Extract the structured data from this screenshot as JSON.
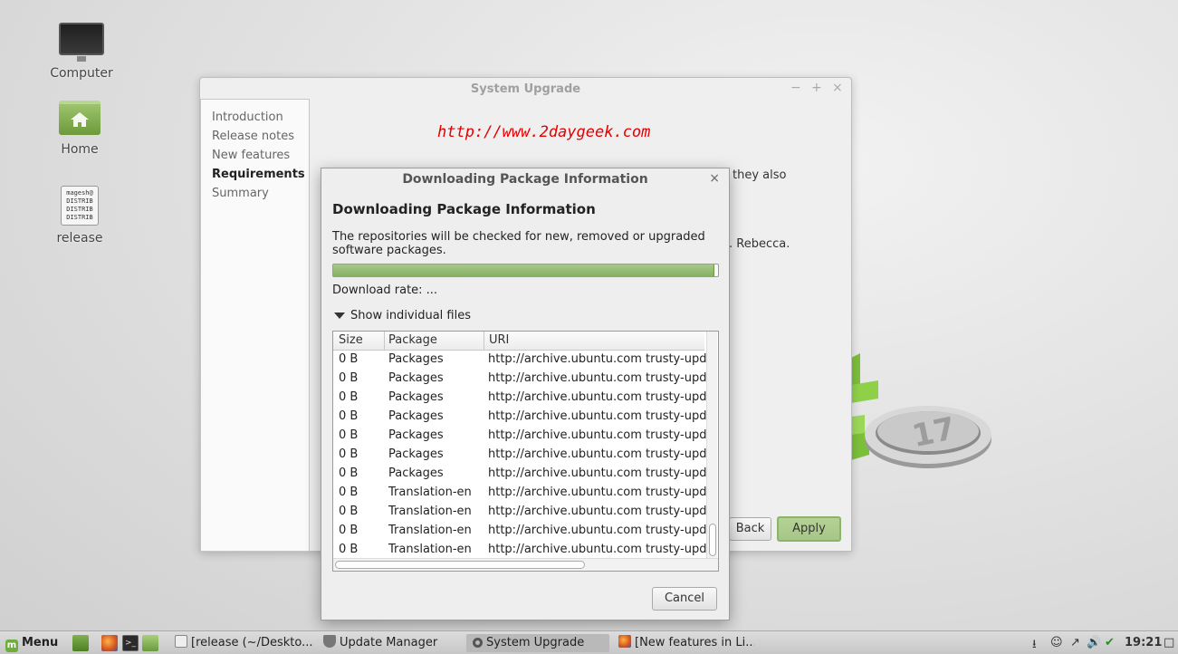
{
  "desktop": {
    "icons": [
      {
        "label": "Computer",
        "icon": "computer-icon"
      },
      {
        "label": "Home",
        "icon": "home-folder-icon"
      },
      {
        "label": "release",
        "icon": "text-file-icon",
        "preview": "magesh@\nDISTRIB\nDISTRIB\nDISTRIB"
      }
    ]
  },
  "main_window": {
    "title": "System Upgrade",
    "controls": {
      "minimize": "−",
      "maximize": "+",
      "close": "×"
    },
    "sidebar": [
      {
        "label": "Introduction",
        "active": false
      },
      {
        "label": "Release notes",
        "active": false
      },
      {
        "label": "New features",
        "active": false
      },
      {
        "label": "Requirements",
        "active": true
      },
      {
        "label": "Summary",
        "active": false
      }
    ],
    "watermark_url": "http://www.2daygeek.com",
    "peek_text_1": "they also",
    "peek_text_2": ". Rebecca.",
    "back_label": "Back",
    "apply_label": "Apply"
  },
  "dialog": {
    "title": "Downloading Package Information",
    "close": "×",
    "heading": "Downloading Package Information",
    "description": "The repositories will be checked for new, removed or upgraded software packages.",
    "progress": 0.99,
    "download_rate": "Download rate: ...",
    "expander_label": "Show individual files",
    "columns": [
      "Size",
      "Package",
      "URI"
    ],
    "rows": [
      [
        "0  B",
        "Packages",
        "http://archive.ubuntu.com trusty-updat"
      ],
      [
        "0  B",
        "Packages",
        "http://archive.ubuntu.com trusty-updat"
      ],
      [
        "0  B",
        "Packages",
        "http://archive.ubuntu.com trusty-updat"
      ],
      [
        "0  B",
        "Packages",
        "http://archive.ubuntu.com trusty-updat"
      ],
      [
        "0  B",
        "Packages",
        "http://archive.ubuntu.com trusty-updat"
      ],
      [
        "0  B",
        "Packages",
        "http://archive.ubuntu.com trusty-updat"
      ],
      [
        "0  B",
        "Packages",
        "http://archive.ubuntu.com trusty-updat"
      ],
      [
        "0  B",
        "Translation-en",
        "http://archive.ubuntu.com trusty-updat"
      ],
      [
        "0  B",
        "Translation-en",
        "http://archive.ubuntu.com trusty-updat"
      ],
      [
        "0  B",
        "Translation-en",
        "http://archive.ubuntu.com trusty-updat"
      ],
      [
        "0  B",
        "Translation-en",
        "http://archive.ubuntu.com trusty-updat"
      ]
    ],
    "cancel_label": "Cancel"
  },
  "taskbar": {
    "menu_label": "Menu",
    "quick_launch": [
      "show-desktop-icon",
      "firefox-icon",
      "terminal-icon",
      "files-icon"
    ],
    "windows": [
      {
        "label": "[release (~/Deskto...",
        "icon": "text-editor-icon",
        "active": false
      },
      {
        "label": "Update Manager",
        "icon": "shield-icon",
        "active": false
      },
      {
        "label": "System Upgrade",
        "icon": "gear-icon",
        "active": true
      },
      {
        "label": "[New features in Li...",
        "icon": "firefox-icon",
        "active": false
      }
    ],
    "tray": [
      "user-icon",
      "network-icon",
      "volume-icon",
      "update-shield-icon",
      "display-icon"
    ],
    "clock": "19:21"
  },
  "colors": {
    "url_red": "#e30000",
    "progress_green": "#93ba6e",
    "apply_green": "#a6c687"
  }
}
